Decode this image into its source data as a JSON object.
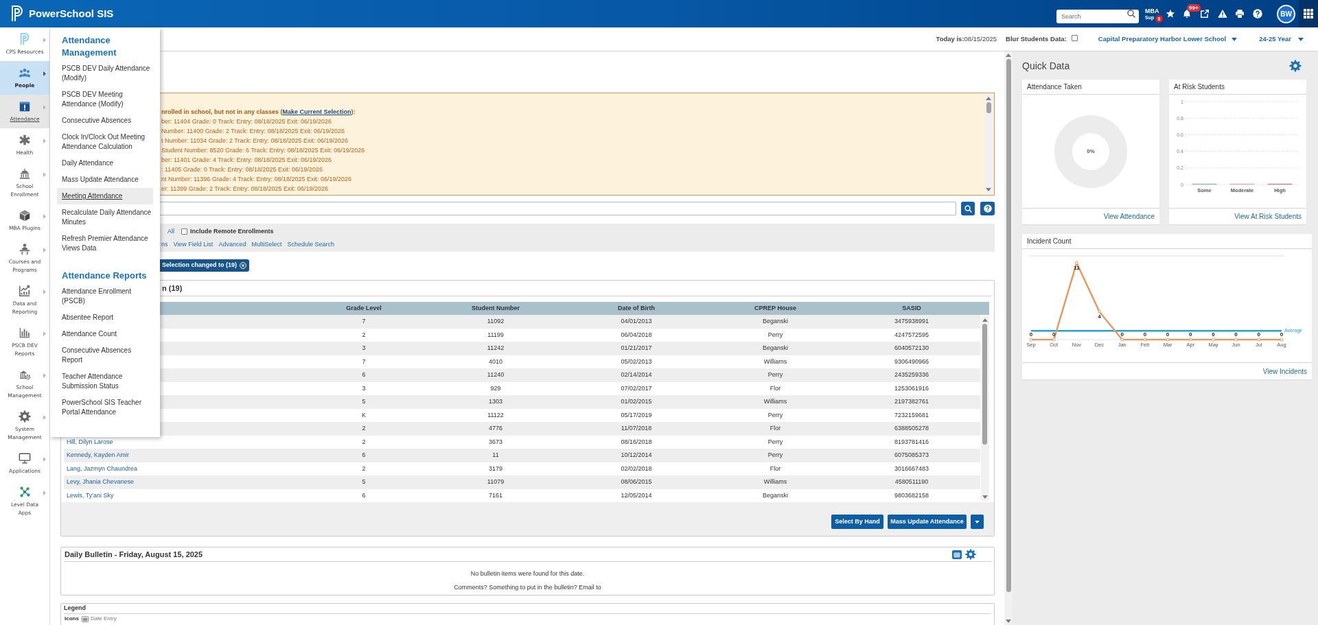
{
  "topbar": {
    "logo_text": "PowerSchool SIS",
    "search": {
      "placeholder": "Search"
    },
    "mba_support": {
      "line_1": "MBA",
      "line_2": "Sup",
      "badge": "8"
    },
    "alerts_badge": "99+",
    "avatar": "BW"
  },
  "header": {
    "today": "**Today is:**08/15/2025",
    "blur_label": "Blur Students Data:",
    "blur_checked": false,
    "school": "Capital Preparatory Harbor Lower School",
    "year": "24-25 Year"
  },
  "sidebar": {
    "items": [
      {
        "label": "CPS Resources",
        "selected": false,
        "expanded": false
      },
      {
        "label": "People",
        "selected": true,
        "expanded": false
      },
      {
        "label": "Attendance",
        "selected": false,
        "expanded": true
      },
      {
        "label": "Health",
        "selected": false,
        "expanded": false
      },
      {
        "label": "School Enrollment",
        "selected": false,
        "expanded": false
      },
      {
        "label": "MBA Plugins",
        "selected": false,
        "expanded": false
      },
      {
        "label": "Courses and Programs",
        "selected": false,
        "expanded": false
      },
      {
        "label": "Data and Reporting",
        "selected": false,
        "expanded": false
      },
      {
        "label": "PSCB DEV Reports",
        "selected": false,
        "expanded": false
      },
      {
        "label": "School Management",
        "selected": false,
        "expanded": false
      },
      {
        "label": "System Management",
        "selected": false,
        "expanded": false
      },
      {
        "label": "Applications",
        "selected": false,
        "expanded": false
      },
      {
        "label": "Level Data Apps",
        "selected": false,
        "expanded": false
      }
    ]
  },
  "flyout_menu": {
    "sections": [
      {
        "heading": "Attendance Management",
        "items": [
          {
            "label": "PSCB DEV Daily Attendance (Modify)",
            "hovered": false
          },
          {
            "label": "PSCB DEV Meeting Attendance (Modify)",
            "hovered": false
          },
          {
            "label": "Consecutive Absences",
            "hovered": false
          },
          {
            "label": "Clock In/Clock Out Meeting Attendance Calculation",
            "hovered": false
          },
          {
            "label": "Daily Attendance",
            "hovered": false
          },
          {
            "label": "Mass Update Attendance",
            "hovered": false
          },
          {
            "label": "Meeting Attendance",
            "hovered": true
          },
          {
            "label": "Recalculate Daily Attendance Minutes",
            "hovered": false
          },
          {
            "label": "Refresh Premier Attendance Views Data",
            "hovered": false
          }
        ]
      },
      {
        "heading": "Attendance Reports",
        "items": [
          {
            "label": "Attendance Enrollment (PSCB)",
            "hovered": false
          },
          {
            "label": "Absentee Report",
            "hovered": false
          },
          {
            "label": "Attendance Count",
            "hovered": false
          },
          {
            "label": "Consecutive Absences Report",
            "hovered": false
          },
          {
            "label": "Teacher Attendance Submission Status",
            "hovered": false
          },
          {
            "label": "PowerSchool SIS Teacher Portal Attendance",
            "hovered": false
          }
        ]
      }
    ]
  },
  "enrollment_alert": {
    "heading": "nrolled in school, but not in any classes (",
    "link": "Make Current Selection",
    "heading_end": "):",
    "lines": [
      "ber: 11404 Grade: 0 Track: Entry: 08/18/2025 Exit: 06/19/2026",
      "Number: 11400 Grade: 2 Track: Entry: 08/18/2025 Exit: 06/19/2026",
      "t Number: 11034 Grade: 2 Track: Entry: 08/18/2025 Exit: 06/19/2026",
      "Student Number: 8520 Grade: 6 Track: Entry: 08/18/2025 Exit: 06/19/2026",
      "ber: 11401 Grade: 4 Track: Entry: 08/18/2025 Exit: 06/19/2026",
      ": 11405 Grade: 0 Track: Entry: 08/18/2025 Exit: 06/19/2026",
      "nt Number: 11396 Grade: 4 Track: Entry: 08/18/2025 Exit: 06/19/2026",
      "er: 11399 Grade: 2 Track: Entry: 08/18/2025 Exit: 06/19/2026"
    ]
  },
  "filter_bar": {
    "scope_link": "All",
    "remote_label": "Include Remote Enrollments",
    "remote_checked": false,
    "links": [
      "ns",
      "View Field List",
      "Advanced",
      "MultiSelect",
      "Schedule Search"
    ]
  },
  "selection_chip": {
    "label": "Selection changed to (19)"
  },
  "selection_table": {
    "title": "n (19)",
    "columns": [
      "Grade Level",
      "Student Number",
      "Date of Birth",
      "CPREP House",
      "SASID"
    ],
    "rows": [
      {
        "grade_level": "7",
        "student_number": "11092",
        "date_of_birth": "04/01/2013",
        "cprep_house": "Beganski",
        "sasid": "3475938991"
      },
      {
        "grade_level": "2",
        "student_number": "11199",
        "date_of_birth": "06/04/2018",
        "cprep_house": "Perry",
        "sasid": "4247572595"
      },
      {
        "grade_level": "3",
        "student_number": "11242",
        "date_of_birth": "01/21/2017",
        "cprep_house": "Beganski",
        "sasid": "6040572130"
      },
      {
        "grade_level": "7",
        "student_number": "4010",
        "date_of_birth": "05/02/2013",
        "cprep_house": "Williams",
        "sasid": "9306490966"
      },
      {
        "grade_level": "6",
        "student_number": "11240",
        "date_of_birth": "02/14/2014",
        "cprep_house": "Perry",
        "sasid": "2435259336"
      },
      {
        "grade_level": "3",
        "student_number": "929",
        "date_of_birth": "07/02/2017",
        "cprep_house": "Flor",
        "sasid": "1253061916"
      },
      {
        "grade_level": "5",
        "student_number": "1303",
        "date_of_birth": "01/02/2015",
        "cprep_house": "Williams",
        "sasid": "2197382761"
      },
      {
        "grade_level": "K",
        "student_number": "11122",
        "date_of_birth": "05/17/2019",
        "cprep_house": "Perry",
        "sasid": "7232159681"
      },
      {
        "grade_level": "2",
        "student_number": "4776",
        "date_of_birth": "11/07/2018",
        "cprep_house": "Flor",
        "sasid": "6388505278"
      },
      {
        "name": "Hill, Dilyn Larose",
        "grade_level": "2",
        "student_number": "3673",
        "date_of_birth": "08/16/2018",
        "cprep_house": "Perry",
        "sasid": "8193781416"
      },
      {
        "name": "Kennedy, Kayden Amir",
        "grade_level": "6",
        "student_number": "11",
        "date_of_birth": "10/12/2014",
        "cprep_house": "Perry",
        "sasid": "6075085373"
      },
      {
        "name": "Lang, Jazmyn Chaundrea",
        "grade_level": "2",
        "student_number": "3179",
        "date_of_birth": "02/02/2018",
        "cprep_house": "Flor",
        "sasid": "3016667483"
      },
      {
        "name": "Levy, Jhania Chevanese",
        "grade_level": "5",
        "student_number": "11079",
        "date_of_birth": "08/06/2015",
        "cprep_house": "Williams",
        "sasid": "4580511190"
      },
      {
        "name": "Lewis, Ty'ani Sky",
        "grade_level": "6",
        "student_number": "7161",
        "date_of_birth": "12/05/2014",
        "cprep_house": "Beganski",
        "sasid": "9803682158"
      }
    ],
    "buttons": [
      "Select By Hand",
      "Mass Update Attendance"
    ]
  },
  "daily_bulletin": {
    "title": "Daily Bulletin - Friday, August 15, 2025",
    "lines": [
      "No bulletin items were found for this date.",
      "Comments? Something to put in the bulletin? Email to"
    ]
  },
  "legend": {
    "title": "Legend",
    "label": "Icons",
    "entries": [
      {
        "label": "Date Entry"
      }
    ]
  },
  "quick_data": {
    "title": "Quick Data",
    "attendance_taken": {
      "title": "Attendance Taken",
      "center_label": "0%",
      "link": "View Attendance"
    },
    "at_risk": {
      "link": "View At Risk Students",
      "chart_data": {
        "type": "bar",
        "title": "At Risk Students",
        "categories": [
          "Some",
          "Moderate",
          "High"
        ],
        "values": [
          0,
          0,
          0
        ],
        "ylim": [
          0,
          1
        ],
        "yticks": [
          0,
          0.2,
          0.4,
          0.6,
          0.8,
          1
        ],
        "grid": true
      }
    },
    "incident_count": {
      "link": "View Incidents",
      "average_label": "Average",
      "chart_data": {
        "type": "line",
        "title": "Incident Count",
        "categories": [
          "Sep",
          "Oct",
          "Nov",
          "Dec",
          "Jan",
          "Feb",
          "Mar",
          "Apr",
          "May",
          "Jun",
          "Jul",
          "Aug"
        ],
        "series": [
          {
            "color": "#e39b63",
            "marker": "circle",
            "values": [
              0,
              0,
              11,
              4,
              0,
              0,
              0,
              0,
              0,
              0,
              0,
              0
            ]
          }
        ],
        "ylim": [
          0,
          12
        ],
        "data_labels": true
      }
    }
  }
}
